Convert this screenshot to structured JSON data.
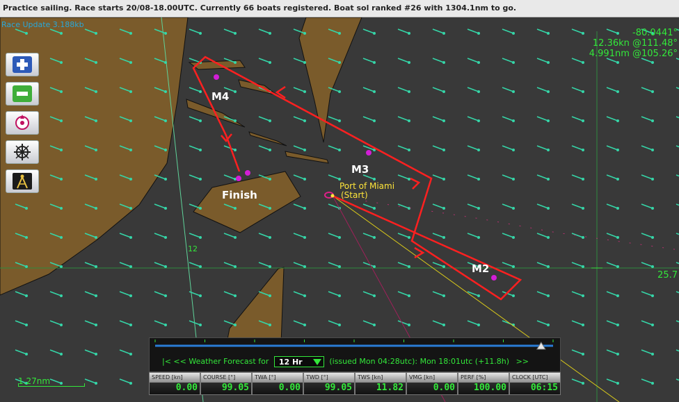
{
  "status_message": "Practice sailing. Race starts 20/08-18.00UTC. Currently 66 boats registered. Boat sol ranked #26 with 1304.1nm to go.",
  "race_update": "Race Update 3.188kb",
  "readouts": {
    "longitude": "-80.0441°",
    "wind": "12.36kn @111.48°",
    "distance": "4.991nm @105.26°",
    "latitude": "25.7"
  },
  "map_labels": {
    "m4": "M4",
    "m3": "M3",
    "m2": "M2",
    "finish": "Finish",
    "start_line1": "Port of Miami",
    "start_line2": "(Start)",
    "depth": "12"
  },
  "toolbar": {
    "icons": [
      "zoom-in-icon",
      "zoom-out-icon",
      "center-boat-icon",
      "helm-icon",
      "compass-icon"
    ]
  },
  "forecast": {
    "nav_back": "|<  <<",
    "label": "Weather Forecast for",
    "selected": "12 Hr",
    "issued": "(issued Mon 04:28utc): Mon 18:01utc  (+11.8h)",
    "nav_fwd": ">>",
    "slider_value": 0.97
  },
  "stats": [
    {
      "label": "SPEED [kn]",
      "value": "0.00"
    },
    {
      "label": "COURSE [°]",
      "value": "99.05"
    },
    {
      "label": "TWA [°]",
      "value": "0.00"
    },
    {
      "label": "TWD [°]",
      "value": "99.05"
    },
    {
      "label": "TWS [kn]",
      "value": "11.82"
    },
    {
      "label": "VMG [kn]",
      "value": "0.00"
    },
    {
      "label": "PERF [%]",
      "value": "100.00"
    },
    {
      "label": "CLOCK [UTC]",
      "value": "06:15"
    }
  ],
  "scale_label": "1.27nm",
  "colors": {
    "sea": "#3a3a3a",
    "land": "#7a5a2a",
    "wind_arrow": "#35d6a8",
    "route": "#ff2020",
    "marker": "#d21ed6",
    "readout": "#33e83a"
  }
}
